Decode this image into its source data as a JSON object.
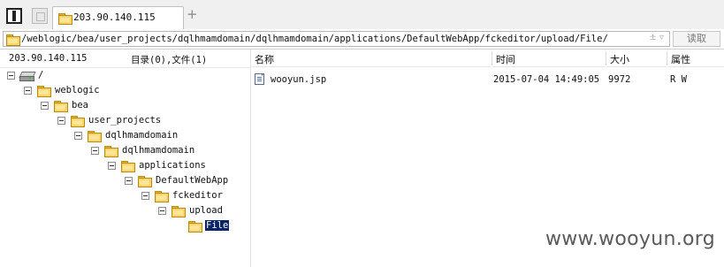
{
  "tabs": [
    {
      "label": "203.90.140.115"
    }
  ],
  "address": {
    "path": "/weblogic/bea/user_projects/dqlhmamdomain/dqlhmamdomain/applications/DefaultWebApp/fckeditor/upload/File/",
    "arrows": "± ▿",
    "read_label": "读取"
  },
  "left_panel": {
    "host": "203.90.140.115",
    "counts": "目录(0),文件(1)"
  },
  "tree": [
    {
      "label": "/",
      "icon": "drive-icon"
    },
    {
      "label": "weblogic",
      "icon": "folder-icon"
    },
    {
      "label": "bea",
      "icon": "folder-icon"
    },
    {
      "label": "user_projects",
      "icon": "folder-icon"
    },
    {
      "label": "dqlhmamdomain",
      "icon": "folder-icon"
    },
    {
      "label": "dqlhmamdomain",
      "icon": "folder-icon"
    },
    {
      "label": "applications",
      "icon": "folder-icon"
    },
    {
      "label": "DefaultWebApp",
      "icon": "folder-icon"
    },
    {
      "label": "fckeditor",
      "icon": "folder-icon"
    },
    {
      "label": "upload",
      "icon": "folder-icon"
    },
    {
      "label": "File",
      "icon": "folder-icon",
      "selected": true
    }
  ],
  "file_list": {
    "columns": [
      "名称",
      "时间",
      "大小",
      "属性"
    ],
    "rows": [
      {
        "name": "wooyun.jsp",
        "time": "2015-07-04 14:49:05",
        "size": "9972",
        "attr": "R W",
        "icon": "file-icon"
      }
    ]
  },
  "watermark": "www.wooyun.org",
  "colors": {
    "selection": "#0a246a",
    "folder": "#f9d56b"
  }
}
